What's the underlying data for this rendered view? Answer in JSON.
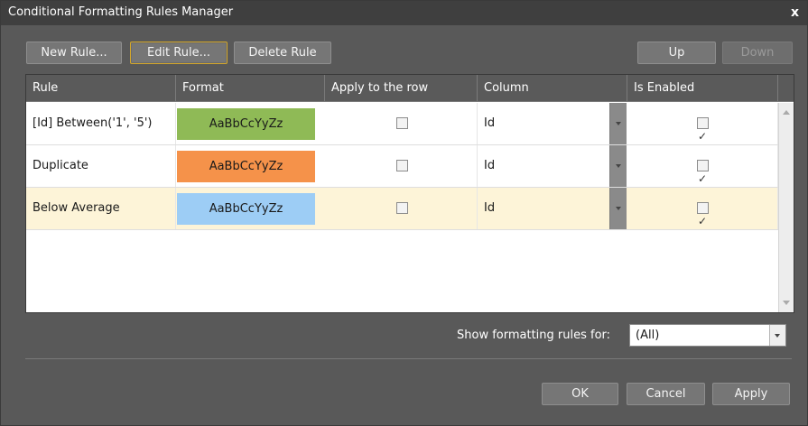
{
  "window": {
    "title": "Conditional Formatting Rules Manager",
    "close_glyph": "x"
  },
  "toolbar": {
    "new_rule": "New Rule...",
    "edit_rule": "Edit Rule...",
    "delete_rule": "Delete Rule",
    "up": "Up",
    "down": "Down"
  },
  "grid": {
    "columns": [
      "Rule",
      "Format",
      "Apply to the row",
      "Column",
      "Is Enabled"
    ],
    "rows": [
      {
        "rule": "[Id] Between('1', '5')",
        "format": "AaBbCcYyZz",
        "format_color": "#8fba56",
        "apply_to_row": false,
        "column": "Id",
        "enabled": true,
        "selected": false
      },
      {
        "rule": "Duplicate",
        "format": "AaBbCcYyZz",
        "format_color": "#f5924a",
        "apply_to_row": false,
        "column": "Id",
        "enabled": true,
        "selected": false
      },
      {
        "rule": "Below Average",
        "format": "AaBbCcYyZz",
        "format_color": "#9dcdf5",
        "apply_to_row": false,
        "column": "Id",
        "enabled": true,
        "selected": true
      }
    ]
  },
  "filter": {
    "label": "Show formatting rules for:",
    "value": "(All)"
  },
  "footer": {
    "ok": "OK",
    "cancel": "Cancel",
    "apply": "Apply"
  },
  "colors": {
    "selected_row": "#fdf4d8",
    "focus_border": "#d4a72a",
    "window_bg": "#595959"
  }
}
